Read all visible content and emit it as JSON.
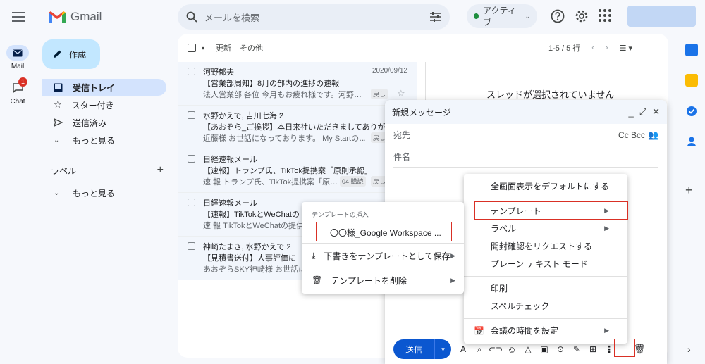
{
  "app": {
    "name": "Gmail"
  },
  "search": {
    "placeholder": "メールを検索"
  },
  "status": {
    "label": "アクティブ"
  },
  "rail": {
    "mail_label": "Mail",
    "chat_label": "Chat",
    "chat_badge": "1"
  },
  "compose_button": {
    "label": "作成"
  },
  "nav": {
    "inbox": "受信トレイ",
    "starred": "スター付き",
    "sent": "送信済み",
    "more": "もっと見る"
  },
  "labels": {
    "heading": "ラベル",
    "add": "+",
    "more": "もっと見る"
  },
  "toolbar": {
    "refresh": "更新",
    "other": "その他",
    "range": "1-5 / 5 行"
  },
  "emails": [
    {
      "sender": "河野郁夫",
      "date": "2020/09/12",
      "subject": "【営業部周知】8月の部内の進捗の速報",
      "snippet": "法人営業部 各位 今月もお疲れ様です。河野…",
      "chip": "戻し"
    },
    {
      "sender": "水野かえで, 吉川七海 2",
      "date": "20",
      "subject": "【あおぞら_ご挨拶】本日来社いただきましてありが",
      "snippet": "近藤様 お世話になっております。 My Startの…",
      "chip": "戻し"
    },
    {
      "sender": "日経速報メール",
      "date": "2020",
      "subject": "【速報】トランプ氏、TikTok提携案「原則承認」",
      "snippet": "速 報 トランプ氏、TikTok提携案「原…",
      "chip": "04 購読",
      "chip2": "戻し"
    },
    {
      "sender": "日経速報メール",
      "date": "",
      "subject": "【速報】TikTokとWeChatの",
      "snippet": "速 報 TikTokとWeChatの提供",
      "chip": ""
    },
    {
      "sender": "神崎たまき, 水野かえで 2",
      "date": "",
      "subject": "【見積書送付】人事評価に",
      "snippet": "あおぞらSKY神崎様 お世話に",
      "chip": ""
    }
  ],
  "reading_pane": {
    "empty_text": "スレッドが選択されていません"
  },
  "composer": {
    "title": "新規メッセージ",
    "to_label": "宛先",
    "cc_bcc": "Cc Bcc",
    "subject_label": "件名",
    "send_label": "送信"
  },
  "more_menu": {
    "items": [
      {
        "label": "全画面表示をデフォルトにする",
        "submenu": false
      },
      {
        "label": "テンプレート",
        "submenu": true
      },
      {
        "label": "ラベル",
        "submenu": true
      },
      {
        "label": "開封確認をリクエストする",
        "submenu": false
      },
      {
        "label": "プレーン テキスト モード",
        "submenu": false
      },
      {
        "label": "印刷",
        "submenu": false
      },
      {
        "label": "スペルチェック",
        "submenu": false
      },
      {
        "label": "会議の時間を設定",
        "submenu": true
      }
    ]
  },
  "template_menu": {
    "section_title": "テンプレートの挿入",
    "template_name": "〇〇様_Google Workspace ...",
    "save_as": "下書きをテンプレートとして保存",
    "delete": "テンプレートを削除"
  },
  "colors": {
    "accent": "#0b57d0",
    "highlight": "#d93025",
    "nav_active": "#d3e3fd",
    "compose": "#c2e7ff"
  }
}
